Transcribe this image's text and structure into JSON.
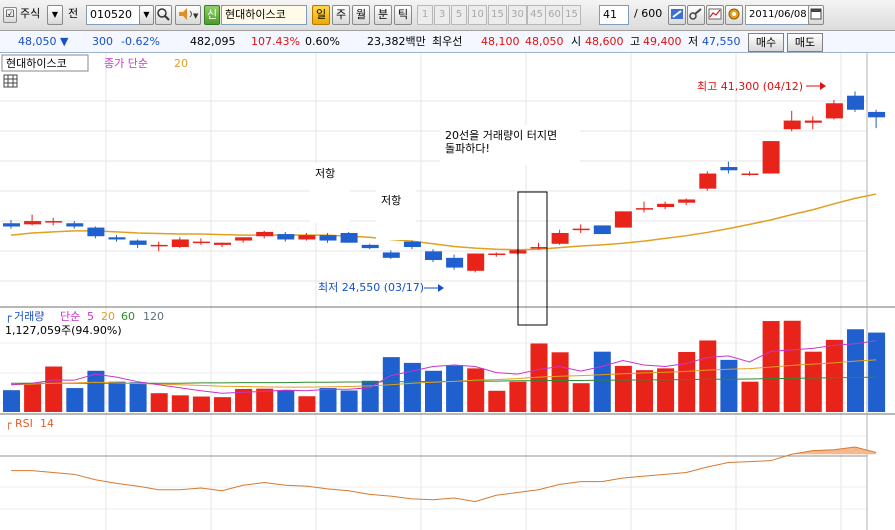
{
  "toolbar": {
    "market": "주식",
    "prefix": "전",
    "code": "010520",
    "sin_label": "신",
    "company": "현대하이스코",
    "period_day": "일",
    "period_week": "주",
    "period_month": "월",
    "period_minute": "분",
    "period_tick": "틱",
    "intervals": [
      "1",
      "3",
      "5",
      "10",
      "15",
      "30",
      "45",
      "60",
      "15"
    ],
    "count": "41",
    "total": "/ 600",
    "date": "2011/06/08"
  },
  "quote": {
    "price": "48,050",
    "change_arrow": "▼",
    "change": "300",
    "change_pct": "-0.62%",
    "volume": "482,095",
    "volume_ratio": "107.43%",
    "turnover_ratio": "0.60%",
    "amount": "23,382백만",
    "priority_label": "최우선",
    "ask": "48,100",
    "bid": "48,050",
    "open_label": "시",
    "open": "48,600",
    "high_label": "고",
    "high": "49,400",
    "low_label": "저",
    "low": "47,550",
    "buy_label": "매수",
    "sell_label": "매도"
  },
  "price_panel": {
    "name": "현대하이스코",
    "indicator": "종가 단순",
    "ma_period": "20",
    "annotations": {
      "resist1": "저항",
      "resist2": "저항",
      "breakout_line1": "20선을 거래량이 터지면",
      "breakout_line2": "돌파하다!",
      "high": "최고 41,300 (04/12)",
      "low": "최저 24,550 (03/17)"
    }
  },
  "volume_panel": {
    "name": "거래량",
    "indicator": "단순",
    "periods": [
      "5",
      "20",
      "60",
      "120"
    ],
    "value_text": "1,127,059주(94.90%)"
  },
  "rsi_panel": {
    "name": "RSI",
    "period": "14"
  },
  "colors": {
    "up": "#e8231a",
    "down": "#1f5fce",
    "ma20": "#e0a020",
    "ma5": "#cc33cc",
    "ma60": "#2e8b2e",
    "ma120": "#607080",
    "rsi_line": "#d87a30",
    "rsi_fill": "#f5b890"
  },
  "chart_data": {
    "type": "candlestick",
    "price_range": [
      22000,
      43000
    ],
    "candles": [
      {
        "o": 29100,
        "h": 29400,
        "l": 28600,
        "c": 28800
      },
      {
        "o": 29000,
        "h": 29900,
        "l": 28900,
        "c": 29300
      },
      {
        "o": 29200,
        "h": 29600,
        "l": 28900,
        "c": 29300
      },
      {
        "o": 29100,
        "h": 29300,
        "l": 28600,
        "c": 28800
      },
      {
        "o": 28700,
        "h": 28800,
        "l": 27700,
        "c": 27900
      },
      {
        "o": 27800,
        "h": 28000,
        "l": 27400,
        "c": 27600
      },
      {
        "o": 27500,
        "h": 27600,
        "l": 26800,
        "c": 27100
      },
      {
        "o": 27100,
        "h": 27400,
        "l": 26500,
        "c": 27100
      },
      {
        "o": 26900,
        "h": 27800,
        "l": 26800,
        "c": 27600
      },
      {
        "o": 27400,
        "h": 27700,
        "l": 27100,
        "c": 27400
      },
      {
        "o": 27100,
        "h": 27300,
        "l": 26900,
        "c": 27300
      },
      {
        "o": 27500,
        "h": 27800,
        "l": 27300,
        "c": 27800
      },
      {
        "o": 27900,
        "h": 28400,
        "l": 27700,
        "c": 28300
      },
      {
        "o": 28100,
        "h": 28300,
        "l": 27400,
        "c": 27600
      },
      {
        "o": 27600,
        "h": 28200,
        "l": 27500,
        "c": 28000
      },
      {
        "o": 28000,
        "h": 28200,
        "l": 27300,
        "c": 27500
      },
      {
        "o": 28200,
        "h": 28300,
        "l": 27300,
        "c": 27300
      },
      {
        "o": 27100,
        "h": 27200,
        "l": 26700,
        "c": 26800
      },
      {
        "o": 26400,
        "h": 26600,
        "l": 25800,
        "c": 25900
      },
      {
        "o": 27400,
        "h": 27500,
        "l": 26700,
        "c": 26900
      },
      {
        "o": 26500,
        "h": 26700,
        "l": 25500,
        "c": 25700
      },
      {
        "o": 25900,
        "h": 26200,
        "l": 24800,
        "c": 25000
      },
      {
        "o": 24700,
        "h": 26300,
        "l": 24550,
        "c": 26300
      },
      {
        "o": 26200,
        "h": 26400,
        "l": 26000,
        "c": 26300
      },
      {
        "o": 26300,
        "h": 26700,
        "l": 26200,
        "c": 26600
      },
      {
        "o": 26900,
        "h": 27300,
        "l": 26700,
        "c": 26900
      },
      {
        "o": 27200,
        "h": 28500,
        "l": 27100,
        "c": 28200
      },
      {
        "o": 28500,
        "h": 29000,
        "l": 28200,
        "c": 28600
      },
      {
        "o": 28900,
        "h": 28900,
        "l": 28100,
        "c": 28100
      },
      {
        "o": 28700,
        "h": 30200,
        "l": 28700,
        "c": 30200
      },
      {
        "o": 30400,
        "h": 31100,
        "l": 30100,
        "c": 30500
      },
      {
        "o": 30600,
        "h": 31100,
        "l": 30400,
        "c": 30900
      },
      {
        "o": 31000,
        "h": 31400,
        "l": 30800,
        "c": 31300
      },
      {
        "o": 32300,
        "h": 33900,
        "l": 32100,
        "c": 33700
      },
      {
        "o": 34300,
        "h": 34800,
        "l": 33700,
        "c": 34000
      },
      {
        "o": 33700,
        "h": 33900,
        "l": 33500,
        "c": 33700
      },
      {
        "o": 33700,
        "h": 36700,
        "l": 33700,
        "c": 36700
      },
      {
        "o": 37800,
        "h": 39500,
        "l": 37600,
        "c": 38600
      },
      {
        "o": 38400,
        "h": 39000,
        "l": 37800,
        "c": 38600
      },
      {
        "o": 38800,
        "h": 40500,
        "l": 38700,
        "c": 40200
      },
      {
        "o": 40900,
        "h": 41300,
        "l": 39400,
        "c": 39600
      },
      {
        "o": 39400,
        "h": 39600,
        "l": 37900,
        "c": 38900
      }
    ],
    "ma20": [
      28000,
      28200,
      28300,
      28400,
      28400,
      28300,
      28200,
      28150,
      28100,
      28100,
      28050,
      28000,
      28000,
      28000,
      28000,
      28000,
      27900,
      27800,
      27600,
      27450,
      27200,
      26950,
      26800,
      26700,
      26650,
      26700,
      26850,
      27000,
      27100,
      27250,
      27450,
      27700,
      27950,
      28250,
      28600,
      29000,
      29400,
      29900,
      30350,
      30900,
      31400,
      31800
    ],
    "volume_range": [
      0,
      3200000
    ],
    "volumes": [
      720000,
      960000,
      1500000,
      790000,
      1360000,
      1000000,
      980000,
      620000,
      550000,
      510000,
      490000,
      760000,
      770000,
      720000,
      520000,
      790000,
      710000,
      1030000,
      1810000,
      1620000,
      1360000,
      1530000,
      1440000,
      700000,
      1000000,
      2260000,
      1970000,
      950000,
      1990000,
      1520000,
      1380000,
      1440000,
      1980000,
      2360000,
      1720000,
      1000000,
      3000000,
      3010000,
      1990000,
      2380000,
      2730000,
      2620000
    ],
    "vol_ma5": [
      900000,
      950000,
      1050000,
      1050000,
      1250000,
      1150000,
      1000000,
      900000,
      800000,
      700000,
      620000,
      650000,
      680000,
      720000,
      700000,
      750000,
      750000,
      800000,
      1200000,
      1350000,
      1500000,
      1550000,
      1500000,
      1300000,
      1250000,
      1400000,
      1500000,
      1350000,
      1500000,
      1700000,
      1550000,
      1500000,
      1600000,
      1800000,
      1850000,
      1650000,
      2000000,
      2050000,
      2100000,
      2200000,
      2250000,
      2350000
    ],
    "vol_ma20": [
      900000,
      920000,
      950000,
      960000,
      980000,
      960000,
      940000,
      920000,
      900000,
      880000,
      850000,
      840000,
      830000,
      820000,
      820000,
      830000,
      840000,
      860000,
      900000,
      950000,
      980000,
      1010000,
      1050000,
      1070000,
      1100000,
      1150000,
      1180000,
      1200000,
      1230000,
      1260000,
      1290000,
      1310000,
      1340000,
      1380000,
      1410000,
      1430000,
      1480000,
      1540000,
      1580000,
      1620000,
      1680000,
      1720000
    ],
    "vol_ma60": [
      950000,
      950000,
      950000,
      950000,
      950000,
      950000,
      950000,
      950000,
      950000,
      960000,
      960000,
      970000,
      970000,
      970000,
      980000,
      980000,
      990000,
      990000,
      1000000,
      1000000,
      1010000,
      1010000,
      1020000,
      1020000,
      1030000,
      1030000,
      1040000,
      1040000,
      1050000,
      1050000,
      1060000,
      1060000,
      1070000,
      1080000,
      1080000,
      1090000,
      1100000,
      1110000,
      1120000,
      1130000,
      1140000,
      1150000
    ],
    "rsi_range": [
      0,
      100
    ],
    "rsi": [
      52,
      52,
      50,
      48,
      42,
      38,
      35,
      31,
      31,
      33,
      30,
      36,
      39,
      36,
      35,
      32,
      30,
      26,
      24,
      21,
      20,
      22,
      18,
      25,
      28,
      31,
      37,
      40,
      40,
      44,
      46,
      48,
      50,
      56,
      61,
      62,
      63,
      70,
      74,
      75,
      78,
      72
    ]
  }
}
